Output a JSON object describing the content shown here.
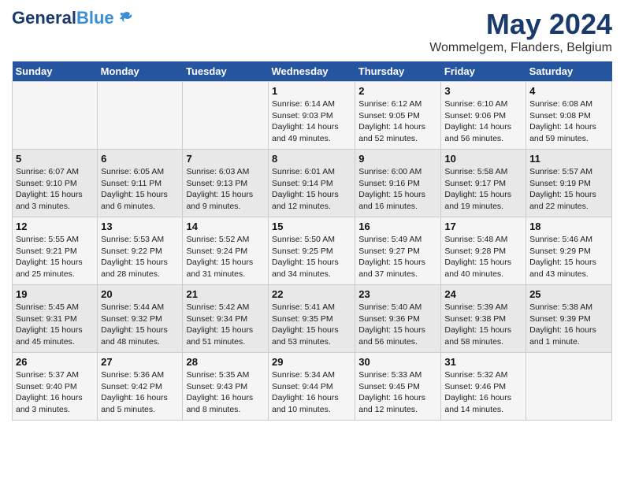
{
  "header": {
    "logo_general": "General",
    "logo_blue": "Blue",
    "month_title": "May 2024",
    "location": "Wommelgem, Flanders, Belgium"
  },
  "days_of_week": [
    "Sunday",
    "Monday",
    "Tuesday",
    "Wednesday",
    "Thursday",
    "Friday",
    "Saturday"
  ],
  "weeks": [
    [
      {
        "num": "",
        "info": ""
      },
      {
        "num": "",
        "info": ""
      },
      {
        "num": "",
        "info": ""
      },
      {
        "num": "1",
        "info": "Sunrise: 6:14 AM\nSunset: 9:03 PM\nDaylight: 14 hours\nand 49 minutes."
      },
      {
        "num": "2",
        "info": "Sunrise: 6:12 AM\nSunset: 9:05 PM\nDaylight: 14 hours\nand 52 minutes."
      },
      {
        "num": "3",
        "info": "Sunrise: 6:10 AM\nSunset: 9:06 PM\nDaylight: 14 hours\nand 56 minutes."
      },
      {
        "num": "4",
        "info": "Sunrise: 6:08 AM\nSunset: 9:08 PM\nDaylight: 14 hours\nand 59 minutes."
      }
    ],
    [
      {
        "num": "5",
        "info": "Sunrise: 6:07 AM\nSunset: 9:10 PM\nDaylight: 15 hours\nand 3 minutes."
      },
      {
        "num": "6",
        "info": "Sunrise: 6:05 AM\nSunset: 9:11 PM\nDaylight: 15 hours\nand 6 minutes."
      },
      {
        "num": "7",
        "info": "Sunrise: 6:03 AM\nSunset: 9:13 PM\nDaylight: 15 hours\nand 9 minutes."
      },
      {
        "num": "8",
        "info": "Sunrise: 6:01 AM\nSunset: 9:14 PM\nDaylight: 15 hours\nand 12 minutes."
      },
      {
        "num": "9",
        "info": "Sunrise: 6:00 AM\nSunset: 9:16 PM\nDaylight: 15 hours\nand 16 minutes."
      },
      {
        "num": "10",
        "info": "Sunrise: 5:58 AM\nSunset: 9:17 PM\nDaylight: 15 hours\nand 19 minutes."
      },
      {
        "num": "11",
        "info": "Sunrise: 5:57 AM\nSunset: 9:19 PM\nDaylight: 15 hours\nand 22 minutes."
      }
    ],
    [
      {
        "num": "12",
        "info": "Sunrise: 5:55 AM\nSunset: 9:21 PM\nDaylight: 15 hours\nand 25 minutes."
      },
      {
        "num": "13",
        "info": "Sunrise: 5:53 AM\nSunset: 9:22 PM\nDaylight: 15 hours\nand 28 minutes."
      },
      {
        "num": "14",
        "info": "Sunrise: 5:52 AM\nSunset: 9:24 PM\nDaylight: 15 hours\nand 31 minutes."
      },
      {
        "num": "15",
        "info": "Sunrise: 5:50 AM\nSunset: 9:25 PM\nDaylight: 15 hours\nand 34 minutes."
      },
      {
        "num": "16",
        "info": "Sunrise: 5:49 AM\nSunset: 9:27 PM\nDaylight: 15 hours\nand 37 minutes."
      },
      {
        "num": "17",
        "info": "Sunrise: 5:48 AM\nSunset: 9:28 PM\nDaylight: 15 hours\nand 40 minutes."
      },
      {
        "num": "18",
        "info": "Sunrise: 5:46 AM\nSunset: 9:29 PM\nDaylight: 15 hours\nand 43 minutes."
      }
    ],
    [
      {
        "num": "19",
        "info": "Sunrise: 5:45 AM\nSunset: 9:31 PM\nDaylight: 15 hours\nand 45 minutes."
      },
      {
        "num": "20",
        "info": "Sunrise: 5:44 AM\nSunset: 9:32 PM\nDaylight: 15 hours\nand 48 minutes."
      },
      {
        "num": "21",
        "info": "Sunrise: 5:42 AM\nSunset: 9:34 PM\nDaylight: 15 hours\nand 51 minutes."
      },
      {
        "num": "22",
        "info": "Sunrise: 5:41 AM\nSunset: 9:35 PM\nDaylight: 15 hours\nand 53 minutes."
      },
      {
        "num": "23",
        "info": "Sunrise: 5:40 AM\nSunset: 9:36 PM\nDaylight: 15 hours\nand 56 minutes."
      },
      {
        "num": "24",
        "info": "Sunrise: 5:39 AM\nSunset: 9:38 PM\nDaylight: 15 hours\nand 58 minutes."
      },
      {
        "num": "25",
        "info": "Sunrise: 5:38 AM\nSunset: 9:39 PM\nDaylight: 16 hours\nand 1 minute."
      }
    ],
    [
      {
        "num": "26",
        "info": "Sunrise: 5:37 AM\nSunset: 9:40 PM\nDaylight: 16 hours\nand 3 minutes."
      },
      {
        "num": "27",
        "info": "Sunrise: 5:36 AM\nSunset: 9:42 PM\nDaylight: 16 hours\nand 5 minutes."
      },
      {
        "num": "28",
        "info": "Sunrise: 5:35 AM\nSunset: 9:43 PM\nDaylight: 16 hours\nand 8 minutes."
      },
      {
        "num": "29",
        "info": "Sunrise: 5:34 AM\nSunset: 9:44 PM\nDaylight: 16 hours\nand 10 minutes."
      },
      {
        "num": "30",
        "info": "Sunrise: 5:33 AM\nSunset: 9:45 PM\nDaylight: 16 hours\nand 12 minutes."
      },
      {
        "num": "31",
        "info": "Sunrise: 5:32 AM\nSunset: 9:46 PM\nDaylight: 16 hours\nand 14 minutes."
      },
      {
        "num": "",
        "info": ""
      }
    ]
  ]
}
